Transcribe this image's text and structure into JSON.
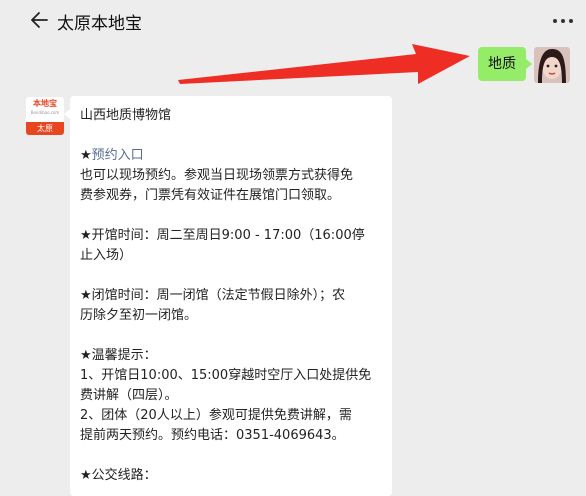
{
  "header": {
    "title": "太原本地宝",
    "back_icon": "back-arrow-icon",
    "more_icon": "more-dots-icon"
  },
  "user_message": {
    "text": "地质",
    "bubble_color": "#95ec69"
  },
  "annotation": {
    "color": "#ee2e24"
  },
  "bot": {
    "logo_top": "本地宝",
    "logo_small": "Bendibao.com",
    "logo_bottom": "太原",
    "brand_color": "#e8461e"
  },
  "bot_message": {
    "line_museum": "山西地质博物馆",
    "star_1": "★",
    "reservation_link": "预约入口",
    "line_walkin_1": "也可以现场预约。参观当日现场领票方式获得免",
    "line_walkin_2": "费参观券，门票凭有效证件在展馆门口领取。",
    "line_open_1": "★开馆时间：周二至周日9:00 - 17:00（16:00停",
    "line_open_2": "止入场）",
    "line_closed_1": "★闭馆时间：周一闭馆（法定节假日除外）；农",
    "line_closed_2": "历除夕至初一闭馆。",
    "line_tips": "★温馨提示：",
    "line_tip1_a": "1、开馆日10:00、15:00穿越时空厅入口处提供免",
    "line_tip1_b": "费讲解（四层）。",
    "line_tip2_a": "2、团体（20人以上）参观可提供免费讲解，需",
    "line_tip2_b": "提前两天预约。预约电话：0351-4069643。",
    "line_bus": "★公交线路："
  }
}
